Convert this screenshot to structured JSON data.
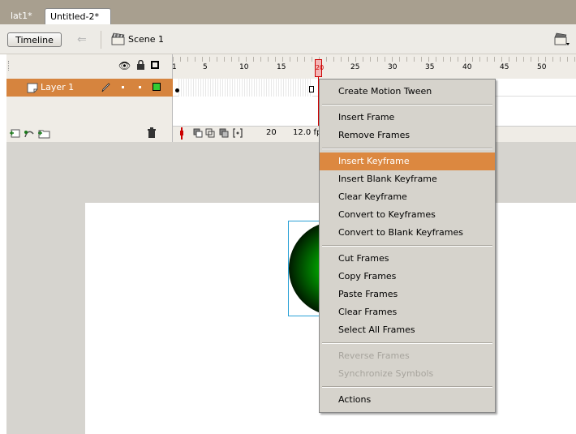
{
  "tabs": [
    {
      "label": "lat1*",
      "active": false
    },
    {
      "label": "Untitled-2*",
      "active": true
    }
  ],
  "scene_bar": {
    "timeline_button": "Timeline",
    "scene_label": "Scene 1"
  },
  "timeline": {
    "ruler_ticks": [
      "1",
      "5",
      "10",
      "15",
      "20",
      "25",
      "30",
      "35",
      "40",
      "45",
      "50"
    ],
    "playhead_frame": "20",
    "layer": {
      "name": "Layer 1",
      "color": "#33cc33"
    },
    "status": {
      "current_frame": "20",
      "frame_rate": "12.0 fp"
    }
  },
  "context_menu": {
    "highlight_color": "#dc8840",
    "groups": [
      [
        {
          "label": "Create Motion Tween",
          "enabled": true
        }
      ],
      [
        {
          "label": "Insert Frame",
          "enabled": true
        },
        {
          "label": "Remove Frames",
          "enabled": true
        }
      ],
      [
        {
          "label": "Insert Keyframe",
          "enabled": true,
          "highlighted": true
        },
        {
          "label": "Insert Blank Keyframe",
          "enabled": true
        },
        {
          "label": "Clear Keyframe",
          "enabled": true
        },
        {
          "label": "Convert to Keyframes",
          "enabled": true
        },
        {
          "label": "Convert to Blank Keyframes",
          "enabled": true
        }
      ],
      [
        {
          "label": "Cut Frames",
          "enabled": true
        },
        {
          "label": "Copy Frames",
          "enabled": true
        },
        {
          "label": "Paste Frames",
          "enabled": true
        },
        {
          "label": "Clear Frames",
          "enabled": true
        },
        {
          "label": "Select All Frames",
          "enabled": true
        }
      ],
      [
        {
          "label": "Reverse Frames",
          "enabled": false
        },
        {
          "label": "Synchronize Symbols",
          "enabled": false
        }
      ],
      [
        {
          "label": "Actions",
          "enabled": true
        }
      ]
    ]
  },
  "icons": {
    "back": "back-arrow-icon",
    "scene": "scene-clapper-icon",
    "edit_scene": "edit-scene-icon",
    "eye": "eye-icon",
    "lock": "lock-icon",
    "outline": "outline-icon",
    "layer": "layer-icon",
    "pencil": "pencil-icon",
    "add_layer": "add-layer-icon",
    "add_guide": "add-motion-guide-icon",
    "add_folder": "add-folder-icon",
    "trash": "trash-icon"
  }
}
